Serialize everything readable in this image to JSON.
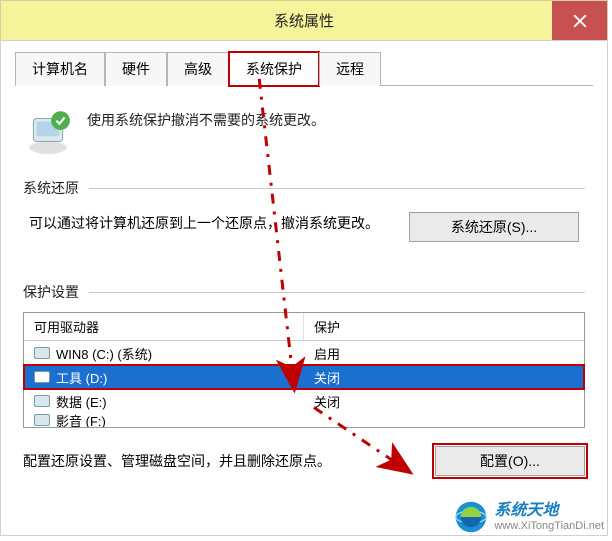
{
  "window": {
    "title": "系统属性"
  },
  "tabs": {
    "items": [
      {
        "label": "计算机名"
      },
      {
        "label": "硬件"
      },
      {
        "label": "高级"
      },
      {
        "label": "系统保护"
      },
      {
        "label": "远程"
      }
    ],
    "active_index": 3,
    "highlight_index": 3
  },
  "intro": {
    "text": "使用系统保护撤消不需要的系统更改。"
  },
  "restore_group": {
    "title": "系统还原",
    "desc": "可以通过将计算机还原到上一个还原点，撤消系统更改。",
    "button_label": "系统还原(S)..."
  },
  "protect_group": {
    "title": "保护设置",
    "header_name": "可用驱动器",
    "header_prot": "保护",
    "rows": [
      {
        "name": "WIN8 (C:) (系统)",
        "prot": "启用",
        "selected": false
      },
      {
        "name": "工具 (D:)",
        "prot": "关闭",
        "selected": true,
        "highlight": true
      },
      {
        "name": "数据 (E:)",
        "prot": "关闭",
        "selected": false
      },
      {
        "name": "影音 (F:)",
        "prot": "",
        "selected": false,
        "partial": true
      }
    ]
  },
  "configure": {
    "text": "配置还原设置、管理磁盘空间，并且删除还原点。",
    "button_label": "配置(O)...",
    "button_highlight": true
  },
  "watermark": {
    "cn": "系统天地",
    "en": "www.XiTongTianDi.net"
  }
}
